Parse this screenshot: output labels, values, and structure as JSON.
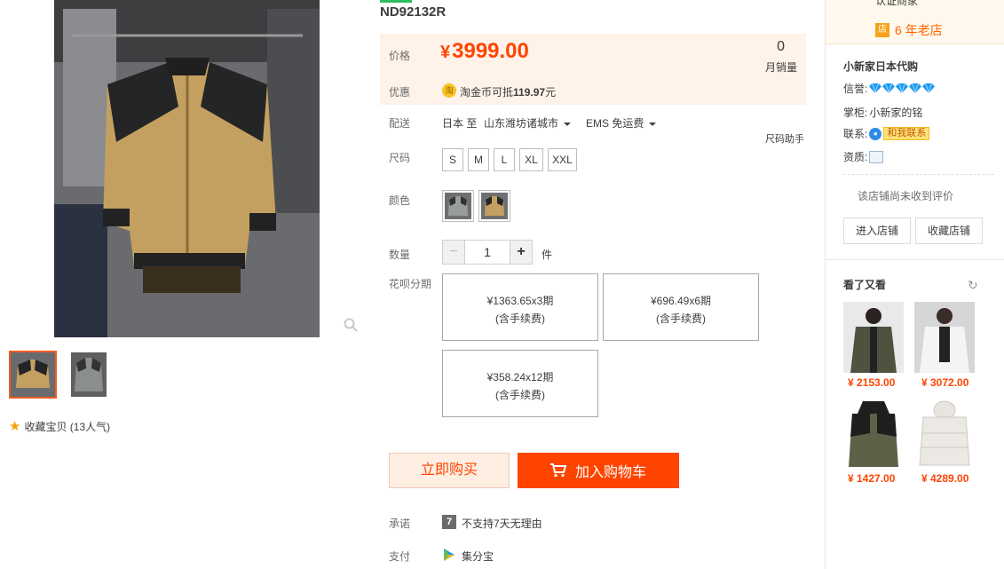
{
  "product": {
    "title": "ND92132R",
    "favorite_label": "收藏宝贝 (13人气)"
  },
  "price": {
    "label": "价格",
    "currency": "¥",
    "value": "3999.00",
    "monthly_sales": "0",
    "monthly_sales_label": "月销量"
  },
  "promo": {
    "label": "优惠",
    "coin_icon": "淘",
    "text_prefix": "淘金币可抵",
    "amount": "119.97",
    "unit": "元"
  },
  "shipping": {
    "label": "配送",
    "from": "日本 至",
    "to": "山东潍坊诸城市",
    "method": "EMS 免运费",
    "size_helper": "尺码助手"
  },
  "size": {
    "label": "尺码",
    "options": [
      "S",
      "M",
      "L",
      "XL",
      "XXL"
    ]
  },
  "color": {
    "label": "颜色"
  },
  "quantity": {
    "label": "数量",
    "minus": "−",
    "value": "1",
    "plus": "+",
    "unit": "件"
  },
  "installment": {
    "label": "花呗分期",
    "options": [
      {
        "line1": "¥1363.65x3期",
        "line2": "(含手续费)"
      },
      {
        "line1": "¥696.49x6期",
        "line2": "(含手续费)"
      },
      {
        "line1": "¥358.24x12期",
        "line2": "(含手续费)"
      }
    ]
  },
  "actions": {
    "buy_now": "立即购买",
    "add_to_cart": "加入购物车"
  },
  "promise": {
    "label": "承诺",
    "icon_text": "7",
    "text": "不支持7天无理由"
  },
  "payment": {
    "label": "支付",
    "text": "集分宝"
  },
  "shop": {
    "top_cut_text": "认证商家",
    "age_icon": "店",
    "age_text": "6 年老店",
    "name": "小新家日本代购",
    "credit_label": "信誉:",
    "keeper_label": "掌柜:",
    "keeper_name": "小新家的铭",
    "contact_label": "联系:",
    "contact_button": "和我联系",
    "qualification_label": "资质:",
    "no_review": "该店铺尚未收到评价",
    "enter_shop": "进入店铺",
    "save_shop": "收藏店铺",
    "diamond_count": 5,
    "diamond_color": "#1d9bf0"
  },
  "recommend": {
    "title": "看了又看",
    "items": [
      {
        "price": "¥ 2153.00"
      },
      {
        "price": "¥ 3072.00"
      },
      {
        "price": "¥ 1427.00"
      },
      {
        "price": "¥ 4289.00"
      }
    ]
  },
  "colors": {
    "accent": "#ff4400",
    "price_bg": "#fff2e8"
  }
}
